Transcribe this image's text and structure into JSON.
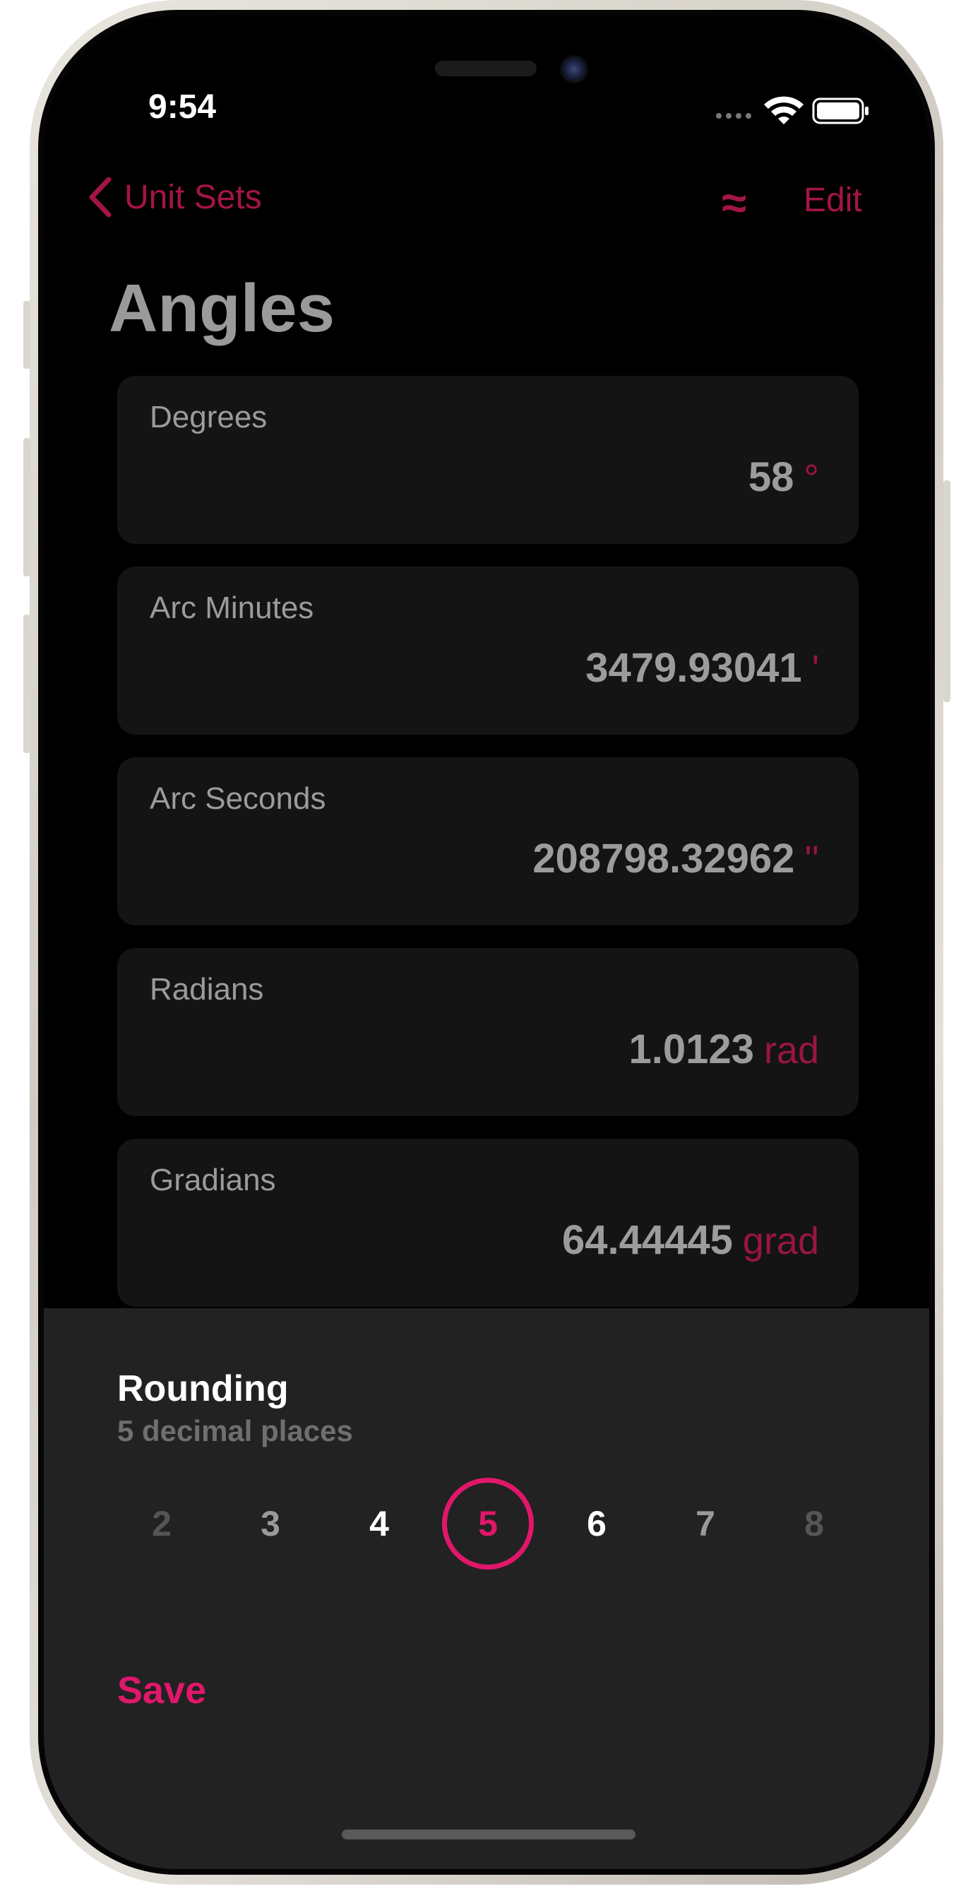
{
  "status": {
    "time": "9:54"
  },
  "nav": {
    "back_label": "Unit Sets",
    "approx_symbol": "≈",
    "edit_label": "Edit"
  },
  "page": {
    "title": "Angles"
  },
  "units": [
    {
      "label": "Degrees",
      "value": "58",
      "unit": "°"
    },
    {
      "label": "Arc Minutes",
      "value": "3479.93041",
      "unit": "'"
    },
    {
      "label": "Arc Seconds",
      "value": "208798.32962",
      "unit": "''"
    },
    {
      "label": "Radians",
      "value": "1.0123",
      "unit": "rad"
    },
    {
      "label": "Gradians",
      "value": "64.44445",
      "unit": "grad"
    }
  ],
  "rounding": {
    "title": "Rounding",
    "subtitle": "5 decimal places",
    "options": [
      "2",
      "3",
      "4",
      "5",
      "6",
      "7",
      "8"
    ],
    "selected": "5",
    "save_label": "Save"
  },
  "colors": {
    "accent": "#e0176a",
    "accent_dim": "#a41448",
    "card_bg": "#141414",
    "sheet_bg": "#222222"
  },
  "icons": [
    "chevron-left-icon",
    "cellular-icon",
    "wifi-icon",
    "battery-icon"
  ]
}
